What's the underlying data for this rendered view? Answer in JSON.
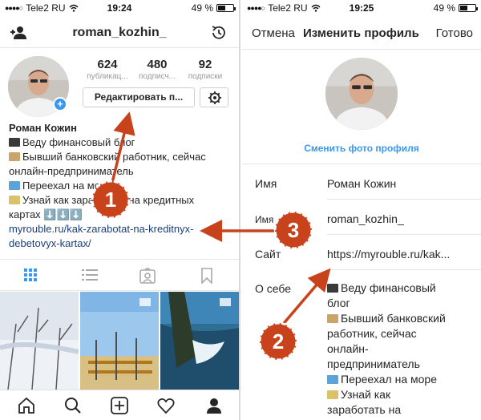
{
  "left": {
    "status": {
      "carrier": "Tele2 RU",
      "time": "19:24",
      "battery": "49 %",
      "battery_level": 0.49
    },
    "header": {
      "username": "roman_kozhin_"
    },
    "stats": [
      {
        "count": "624",
        "label": "публикац..."
      },
      {
        "count": "480",
        "label": "подписч..."
      },
      {
        "count": "92",
        "label": "подписки"
      }
    ],
    "edit_button": "Редактировать п...",
    "bio": {
      "name": "Роман Кожин",
      "lines": [
        "Веду финансовый блог",
        "Бывший банковский работник, сейчас",
        "онлайн-предприниматель",
        "Переехал на море",
        "Узнай как заработать на кредитных",
        "картах ⬇️⬇️⬇️"
      ],
      "link_1": "myrouble.ru/kak-zarabotat-na-kreditnyx-",
      "link_2": "debetovyx-kartax/"
    }
  },
  "right": {
    "status": {
      "carrier": "Tele2 RU",
      "time": "19:25",
      "battery": "49 %",
      "battery_level": 0.49
    },
    "header": {
      "cancel": "Отмена",
      "title": "Изменить профиль",
      "done": "Готово"
    },
    "change_photo": "Сменить фото профиля",
    "fields": [
      {
        "label": "Имя",
        "value": "Роман Кожин"
      },
      {
        "label": "Имя ...",
        "value": "roman_kozhin_"
      },
      {
        "label": "Сайт",
        "value": "https://myrouble.ru/kak..."
      },
      {
        "label": "О себе",
        "value": ""
      }
    ],
    "bio_lines": [
      "Веду финансовый",
      "блог",
      "Бывший банковский",
      "работник, сейчас",
      "онлайн-",
      "предприниматель",
      "Переехал на море",
      "Узнай как",
      "заработать на"
    ]
  },
  "annotations": [
    "1",
    "2",
    "3"
  ],
  "colors": {
    "accent": "#3897f0",
    "marker": "#c8431c",
    "link": "#1b3f79"
  }
}
